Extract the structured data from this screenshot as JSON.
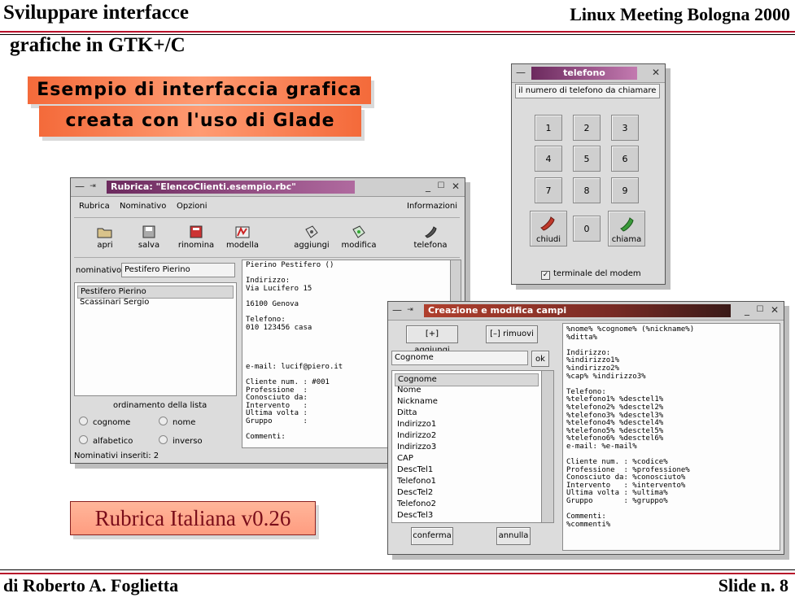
{
  "slide": {
    "title_line1": "Sviluppare interfacce",
    "title_line2": "grafiche in GTK+/C",
    "conference": "Linux Meeting Bologna 2000",
    "banner_line1": "Esempio di interfaccia grafica",
    "banner_line2": "creata con l'uso di Glade",
    "product": "Rubrica Italiana v0.26",
    "author": "di Roberto A. Foglietta",
    "slide_number": "Slide n. 8"
  },
  "rubrica": {
    "title": "Rubrica: \"ElencoClienti.esempio.rbc\"",
    "menu": [
      "Rubrica",
      "Nominativo",
      "Opzioni",
      "Informazioni"
    ],
    "toolbar": [
      "apri",
      "salva",
      "rinomina",
      "modella",
      "aggiungi",
      "modifica",
      "telefona"
    ],
    "nominativo_label": "nominativo",
    "nominativo_value": "Pestifero Pierino",
    "list": [
      "Pestifero Pierino",
      "Scassinari Sergio"
    ],
    "sort_label": "ordinamento della lista",
    "radio": [
      "cognome",
      "nome",
      "alfabetico",
      "inverso"
    ],
    "status": "Nominativi inseriti: 2",
    "detail": "Pierino Pestifero ()\n\nIndirizzo:\nVia Lucifero 15\n\n16100 Genova\n\nTelefono:\n010 123456 casa\n\n\n\n\ne-mail: lucif@piero.it\n\nCliente num. : #001\nProfessione  :\nConosciuto da:\nIntervento   :\nUltima volta :\nGruppo       :\n\nCommenti:"
  },
  "telefono": {
    "title": "telefono",
    "input": "il numero di telefono da chiamare",
    "keys": [
      "1",
      "2",
      "3",
      "4",
      "5",
      "6",
      "7",
      "8",
      "9"
    ],
    "zero": "0",
    "hangup": "chiudi",
    "call": "chiama",
    "modem_label": "terminale del modem"
  },
  "campi": {
    "title": "Creazione e modifica campi",
    "add_label": "[+] aggiungi",
    "remove_label": "[–] rimuovi",
    "field_value": "Cognome",
    "ok_label": "ok",
    "list": [
      "Cognome",
      "Nome",
      "Nickname",
      "Ditta",
      "Indirizzo1",
      "Indirizzo2",
      "Indirizzo3",
      "CAP",
      "DescTel1",
      "Telefono1",
      "DescTel2",
      "Telefono2",
      "DescTel3"
    ],
    "confirm_label": "conferma",
    "cancel_label": "annulla",
    "template": "%nome% %cognome% (%nickname%)\n%ditta%\n\nIndirizzo:\n%indirizzo1%\n%indirizzo2%\n%cap% %indirizzo3%\n\nTelefono:\n%telefono1% %desctel1%\n%telefono2% %desctel2%\n%telefono3% %desctel3%\n%telefono4% %desctel4%\n%telefono5% %desctel5%\n%telefono6% %desctel6%\ne-mail: %e-mail%\n\nCliente num. : %codice%\nProfessione  : %professione%\nConosciuto da: %conosciuto%\nIntervento   : %intervento%\nUltima volta : %ultima%\nGruppo       : %gruppo%\n\nCommenti:\n%commenti%"
  }
}
